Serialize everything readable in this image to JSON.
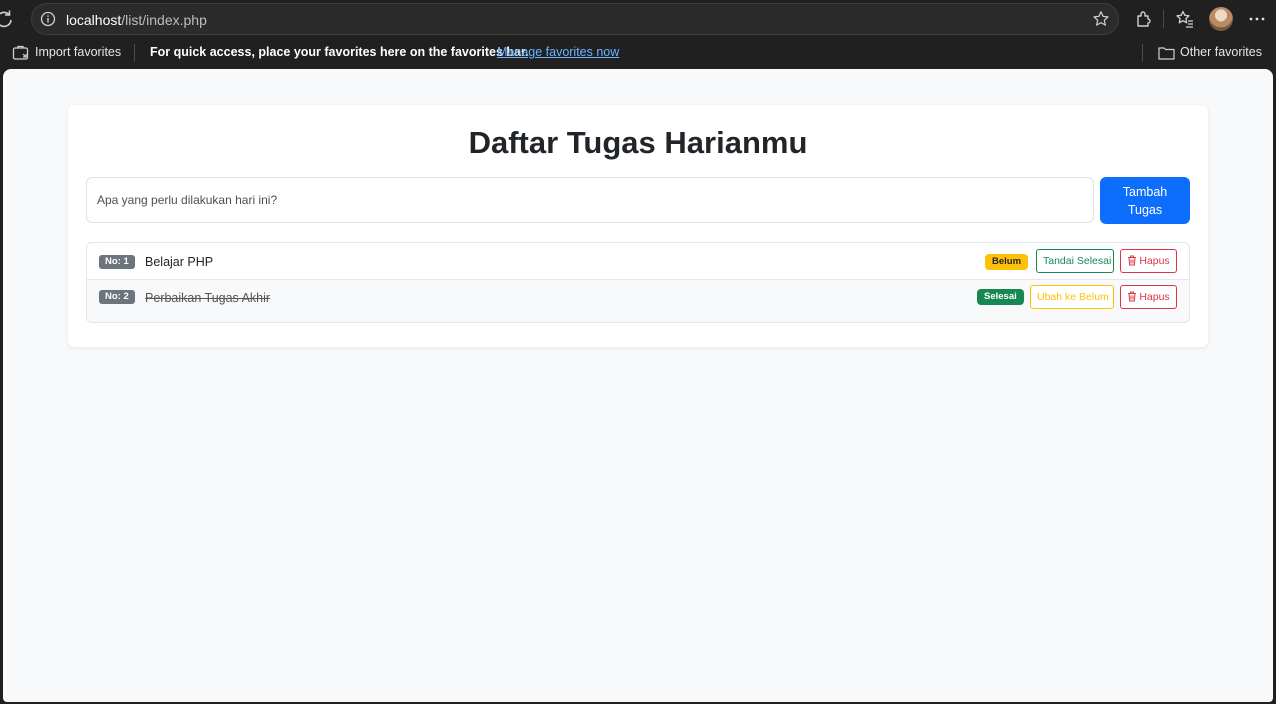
{
  "browser": {
    "url_host": "localhost",
    "url_path": "/list/index.php",
    "favorites": {
      "import_label": "Import favorites",
      "hint": "For quick access, place your favorites here on the favorites bar.",
      "manage_link": "Manage favorites now",
      "other_label": "Other favorites"
    }
  },
  "app": {
    "title": "Daftar Tugas Harianmu",
    "input_placeholder": "Apa yang perlu dilakukan hari ini?",
    "add_button_line1": "Tambah",
    "add_button_line2": "Tugas",
    "tasks": [
      {
        "number": "No: 1",
        "text": "Belajar PHP",
        "status": "Belum",
        "action": "Tandai Selesai",
        "delete": "Hapus"
      },
      {
        "number": "No: 2",
        "text": "Perbaikan Tugas Akhir",
        "status": "Selesai",
        "action": "Ubah ke Belum",
        "delete": "Hapus"
      }
    ]
  },
  "colors": {
    "primary": "#0d6efd",
    "success": "#198754",
    "warning": "#ffc107",
    "danger": "#dc3545",
    "secondary": "#6c757d"
  }
}
